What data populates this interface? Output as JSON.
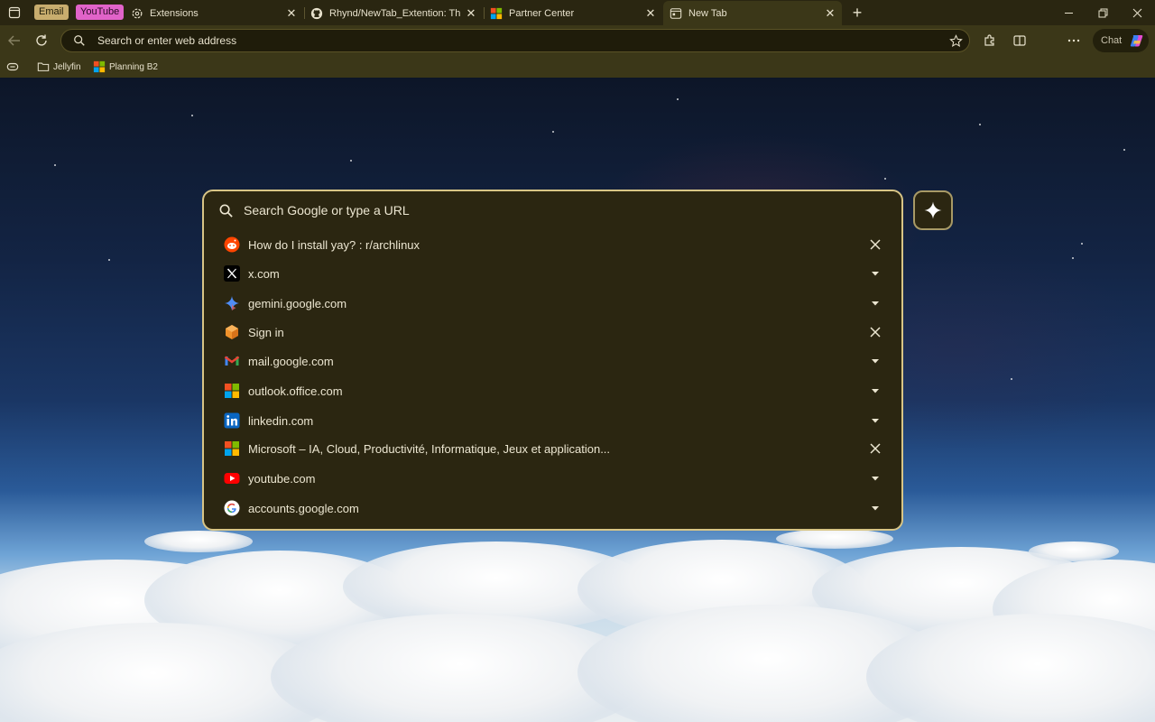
{
  "pinned_tabs": [
    {
      "label": "Email",
      "color": "#c8ad6e"
    },
    {
      "label": "YouTube",
      "color": "#e163c9"
    }
  ],
  "tabs": [
    {
      "title": "Extensions",
      "icon": "extensions-gear-icon",
      "active": false
    },
    {
      "title": "Rhynd/NewTab_Extention: This is a",
      "icon": "github-icon",
      "active": false
    },
    {
      "title": "Partner Center",
      "icon": "microsoft-logo-icon",
      "active": false
    },
    {
      "title": "New Tab",
      "icon": "new-tab-page-icon",
      "active": true
    }
  ],
  "toolbar": {
    "address_placeholder": "Search or enter web address",
    "chat_label": "Chat"
  },
  "bookmarks": [
    {
      "label": "Jellyfin",
      "icon": "folder-icon"
    },
    {
      "label": "Planning B2",
      "icon": "microsoft-logo-icon"
    }
  ],
  "new_tab": {
    "search_placeholder": "Search Google or type a URL",
    "suggestions": [
      {
        "label": "How do I install yay? : r/archlinux",
        "icon": "reddit-icon",
        "action": "remove"
      },
      {
        "label": "x.com",
        "icon": "x-logo-icon",
        "action": "expand"
      },
      {
        "label": "gemini.google.com",
        "icon": "gemini-icon",
        "action": "expand"
      },
      {
        "label": "Sign in",
        "icon": "orange-cube-icon",
        "action": "remove"
      },
      {
        "label": "mail.google.com",
        "icon": "gmail-icon",
        "action": "expand"
      },
      {
        "label": "outlook.office.com",
        "icon": "microsoft-logo-icon",
        "action": "expand"
      },
      {
        "label": "linkedin.com",
        "icon": "linkedin-icon",
        "action": "expand"
      },
      {
        "label": "Microsoft – IA, Cloud, Productivité, Informatique, Jeux et application...",
        "icon": "microsoft-logo-icon",
        "action": "remove"
      },
      {
        "label": "youtube.com",
        "icon": "youtube-icon",
        "action": "expand"
      },
      {
        "label": "accounts.google.com",
        "icon": "google-icon",
        "action": "expand"
      }
    ]
  },
  "colors": {
    "accent_border": "#d8c586",
    "panel_bg": "#2b2611",
    "chrome_bg": "#3b3718"
  }
}
